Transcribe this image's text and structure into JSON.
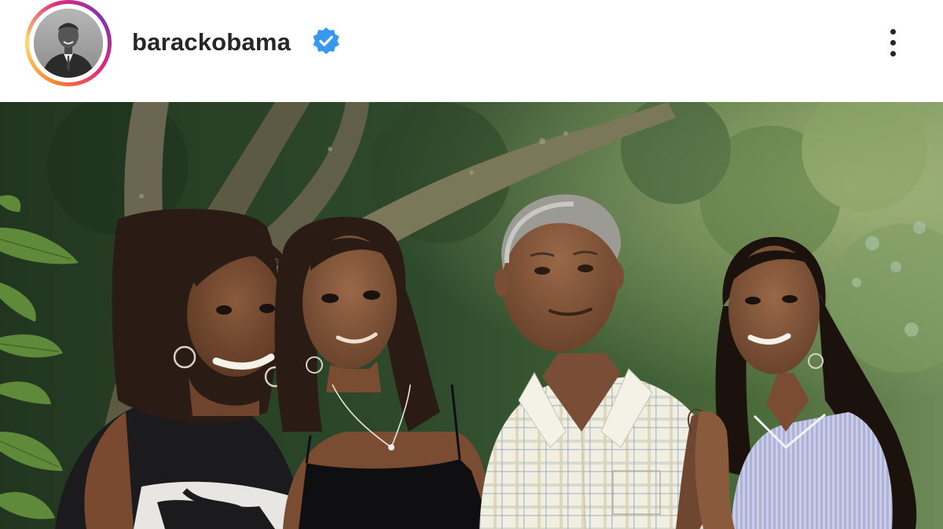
{
  "post_header": {
    "username": "barackobama",
    "verified_icon": "verified-badge-icon",
    "more_icon": "more-vertical-icon",
    "avatar_ring_colors": [
      "#f58529",
      "#feda77",
      "#dd2a7b",
      "#8134af"
    ],
    "verified_color": "#3897f0"
  },
  "post": {
    "media_type": "photo"
  }
}
